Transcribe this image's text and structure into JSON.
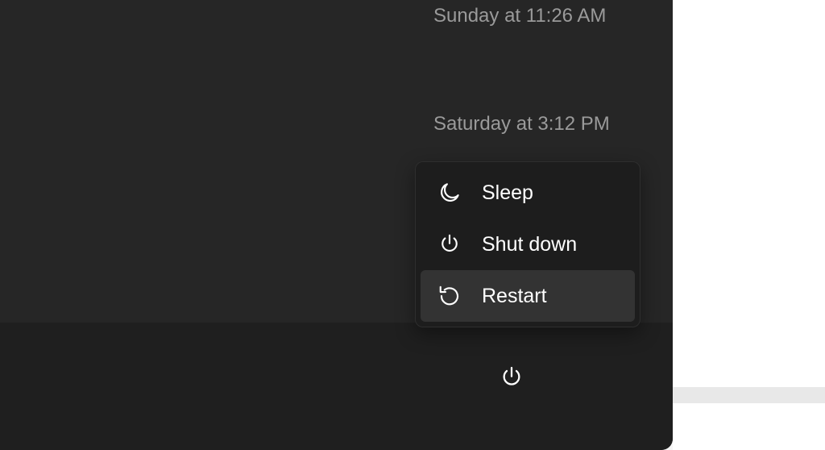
{
  "timestamps": {
    "t1": "Sunday at 11:26 AM",
    "t2": "Saturday at 3:12 PM"
  },
  "power_menu": {
    "sleep": "Sleep",
    "shutdown": "Shut down",
    "restart": "Restart"
  }
}
